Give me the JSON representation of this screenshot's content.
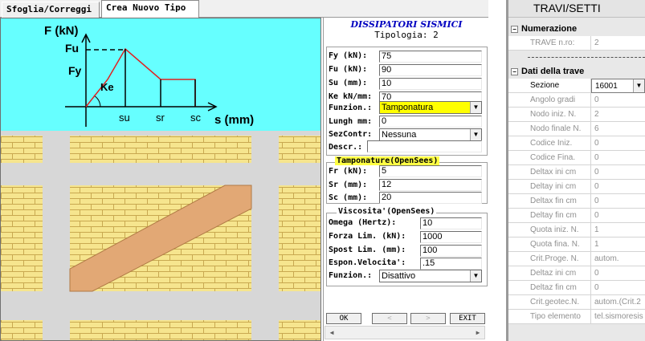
{
  "tabs": [
    "Sfoglia/Correggi",
    "Crea Nuovo Tipo"
  ],
  "diagram": {
    "y_axis_label": "F (kN)",
    "x_axis_label": "s (mm)",
    "fu_label": "Fu",
    "fy_label": "Fy",
    "ke_label": "Ke",
    "su_label": "su",
    "sr_label": "sr",
    "sc_label": "sc"
  },
  "form": {
    "title": "DISSIPATORI SISMICI",
    "tipologia_label": "Tipologia:",
    "tipologia_value": "2",
    "fields": [
      {
        "label": "Fy   (kN):",
        "value": "75"
      },
      {
        "label": "Fu   (kN):",
        "value": "90"
      },
      {
        "label": "Su   (mm):",
        "value": "10"
      },
      {
        "label": "Ke kN/mm:",
        "value": "70"
      }
    ],
    "funzion_label": "Funzion.:",
    "funzion_value": "Tamponatura",
    "lungh_label": "Lungh mm:",
    "lungh_value": "0",
    "sezcontr_label": "SezContr:",
    "sezcontr_value": "Nessuna",
    "descr_label": "Descr.:",
    "descr_value": "",
    "tamponature": {
      "legend": "Tamponature(OpenSees)",
      "fields": [
        {
          "label": "Fr  (kN):",
          "value": "5"
        },
        {
          "label": "Sr   (mm):",
          "value": "12"
        },
        {
          "label": "Sc   (mm):",
          "value": "20"
        }
      ]
    },
    "viscosita": {
      "legend": "Viscosita'(OpenSees)",
      "fields": [
        {
          "label": "Omega   (Hertz):",
          "value": "10"
        },
        {
          "label": "Forza Lim. (kN):",
          "value": "1000"
        },
        {
          "label": "Spost Lim. (mm):",
          "value": "100"
        },
        {
          "label": "Espon.Velocita':",
          "value": ".15"
        }
      ],
      "funzion_label": "Funzion.:",
      "funzion_value": "Disattivo"
    },
    "buttons": {
      "ok": "OK",
      "prev": "<",
      "next": ">",
      "exit": "EXIT"
    }
  },
  "props": {
    "title": "TRAVI/SETTI",
    "section1": "Numerazione",
    "trave_label": "TRAVE n.ro:",
    "trave_value": "2",
    "section2": "Dati della trave",
    "rows": [
      {
        "k": "Sezione",
        "v": "16001"
      },
      {
        "k": "Angolo  gradi",
        "v": "0"
      },
      {
        "k": "Nodo iniz.  N.",
        "v": "2"
      },
      {
        "k": "Nodo finale N.",
        "v": "6"
      },
      {
        "k": "Codice Iniz.",
        "v": "0"
      },
      {
        "k": "Codice Fina.",
        "v": "0"
      },
      {
        "k": "Deltax ini cm",
        "v": "0"
      },
      {
        "k": "Deltay ini cm",
        "v": "0"
      },
      {
        "k": "Deltax fin cm",
        "v": "0"
      },
      {
        "k": "Deltay fin cm",
        "v": "0"
      },
      {
        "k": "Quota iniz. N.",
        "v": "1"
      },
      {
        "k": "Quota fina. N.",
        "v": "1"
      },
      {
        "k": "Crit.Proge. N.",
        "v": "autom."
      },
      {
        "k": "Deltaz ini cm",
        "v": "0"
      },
      {
        "k": "Deltaz fin cm",
        "v": "0"
      },
      {
        "k": "Crit.geotec.N.",
        "v": "autom.(Crit.2"
      },
      {
        "k": "Tipo elemento",
        "v": "tel.sismoresis"
      }
    ]
  },
  "colors": {
    "cyan": "#66ffff",
    "brick": "#f6e58e",
    "mortar": "#c8a850",
    "strut": "#e2a875",
    "highlight": "#ffff00"
  }
}
